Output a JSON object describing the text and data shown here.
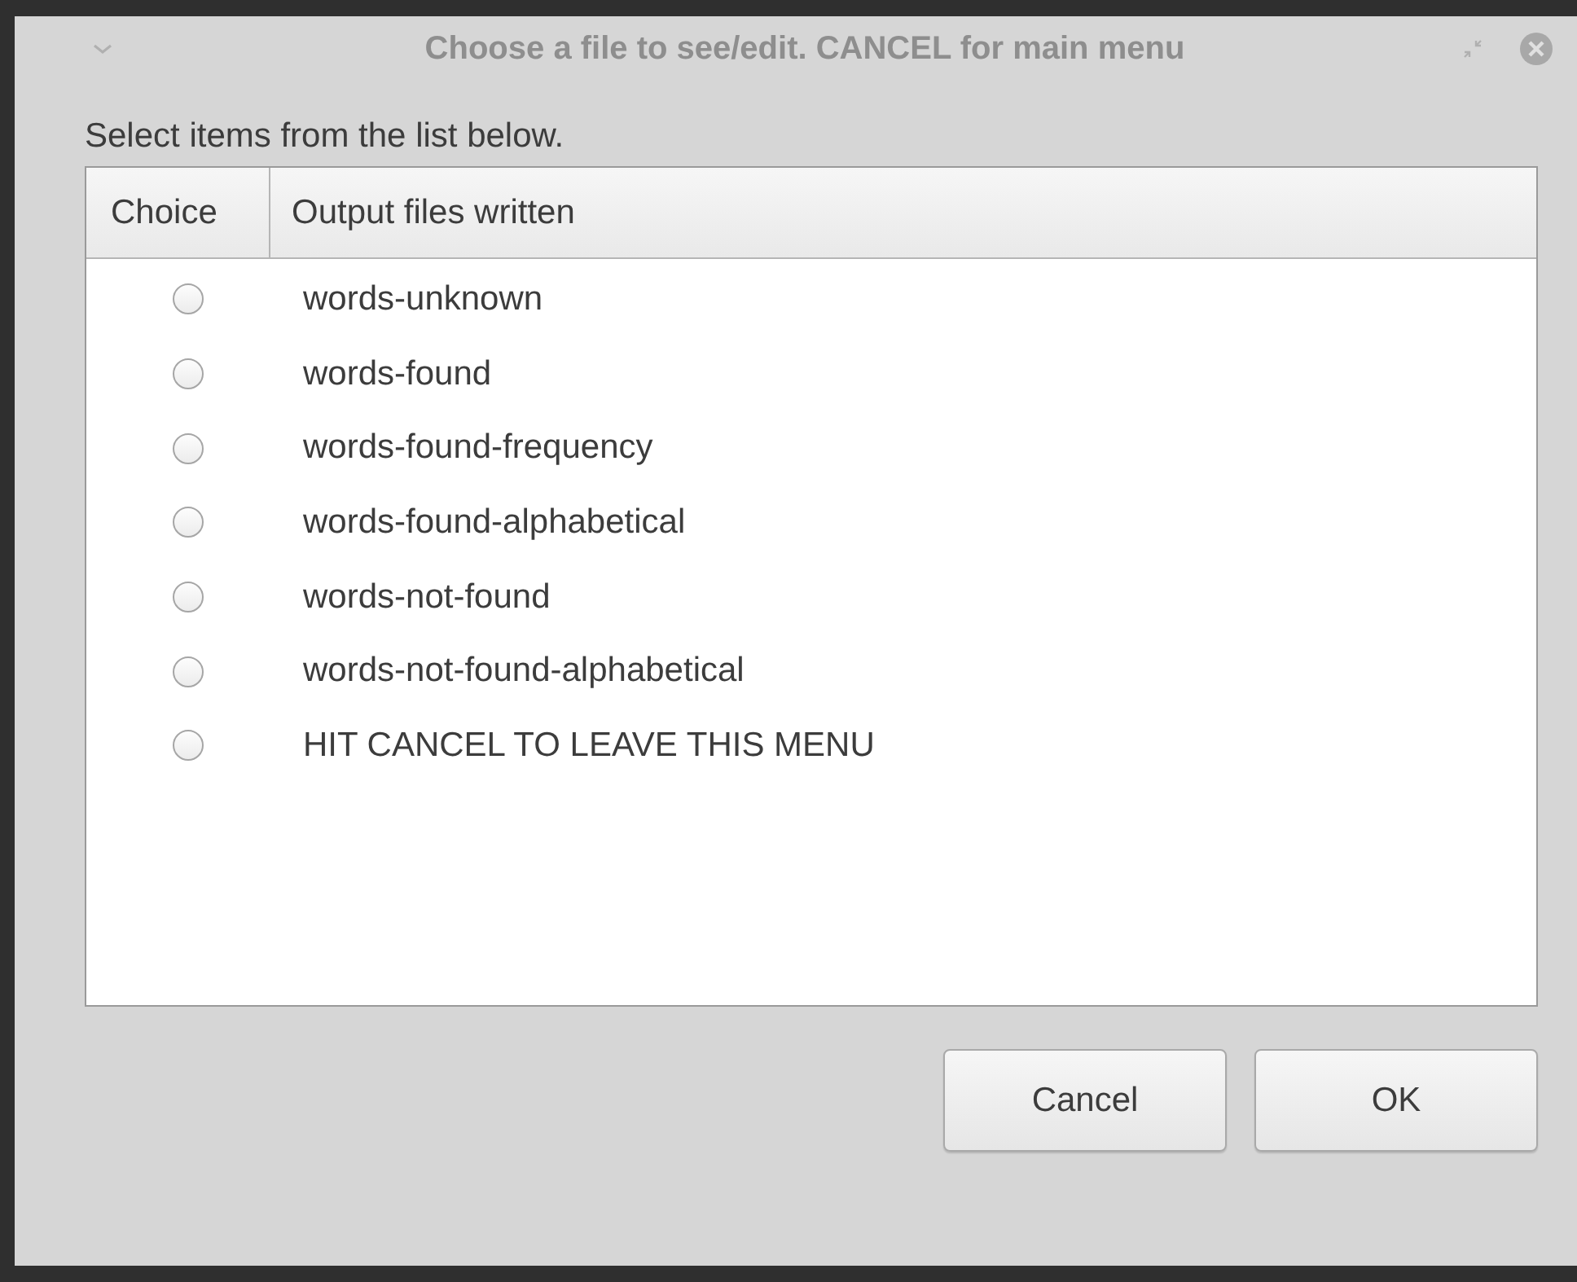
{
  "window": {
    "title": "Choose a file to see/edit. CANCEL for main menu"
  },
  "prompt": "Select items from the list below.",
  "table": {
    "columns": [
      "Choice",
      "Output files written"
    ],
    "rows": [
      {
        "label": "words-unknown",
        "selected": false
      },
      {
        "label": "words-found",
        "selected": false
      },
      {
        "label": "words-found-frequency",
        "selected": false
      },
      {
        "label": "words-found-alphabetical",
        "selected": false
      },
      {
        "label": "words-not-found",
        "selected": false
      },
      {
        "label": "words-not-found-alphabetical",
        "selected": false
      },
      {
        "label": "HIT CANCEL TO LEAVE THIS MENU",
        "selected": false
      }
    ]
  },
  "buttons": [
    "Cancel",
    "OK"
  ]
}
